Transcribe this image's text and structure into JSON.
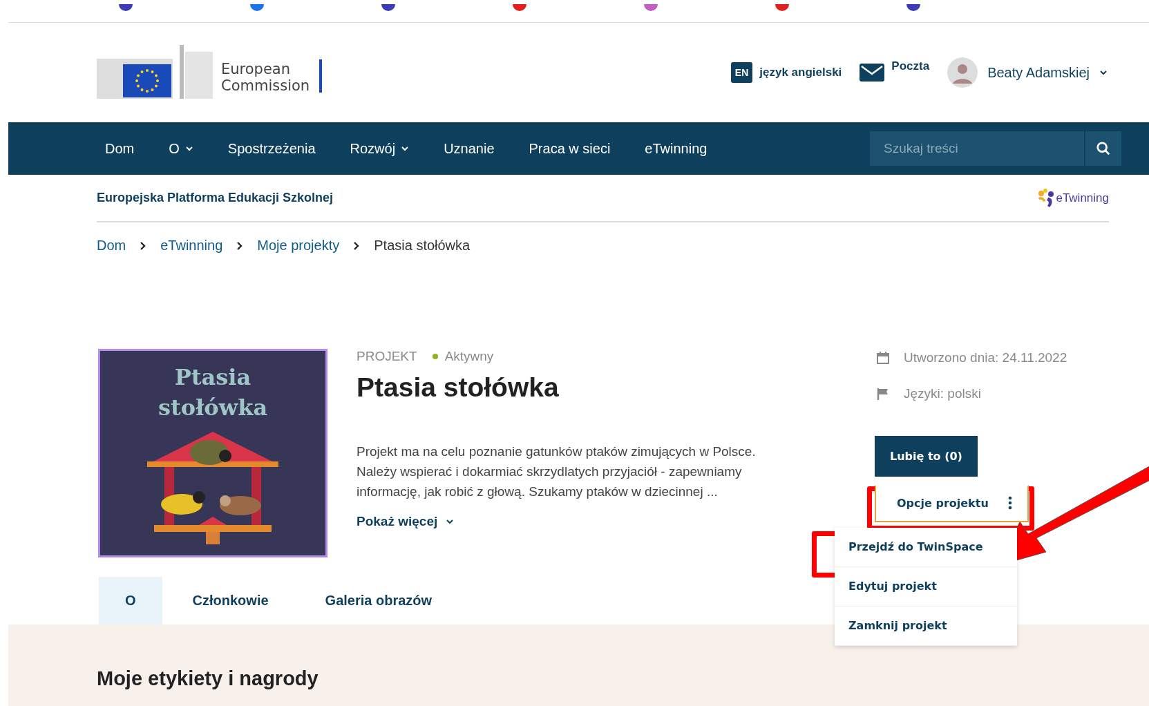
{
  "header": {
    "logo": {
      "line1": "European",
      "line2": "Commission"
    },
    "language": {
      "code": "EN",
      "label": "język angielski"
    },
    "mail": "Poczta",
    "user": "Beaty Adamskiej"
  },
  "nav": {
    "items": [
      {
        "label": "Dom",
        "dropdown": false
      },
      {
        "label": "O",
        "dropdown": true
      },
      {
        "label": "Spostrzeżenia",
        "dropdown": false
      },
      {
        "label": "Rozwój",
        "dropdown": true
      },
      {
        "label": "Uznanie",
        "dropdown": false
      },
      {
        "label": "Praca w sieci",
        "dropdown": false
      },
      {
        "label": "eTwinning",
        "dropdown": false
      }
    ],
    "search": {
      "placeholder": "Szukaj treści"
    }
  },
  "subheader": {
    "title": "Europejska Platforma Edukacji Szkolnej",
    "brand": "eTwinning"
  },
  "breadcrumb": [
    "Dom",
    "eTwinning",
    "Moje projekty",
    "Ptasia stołówka"
  ],
  "project": {
    "cover": {
      "line1": "Ptasia",
      "line2": "stołówka"
    },
    "type": "PROJEKT",
    "status": {
      "label": "Aktywny",
      "color": "#8cb31a"
    },
    "title": "Ptasia stołówka",
    "description": "Projekt ma na celu poznanie gatunków ptaków zimujących w Polsce. Należy wspierać i dokarmiać skrzydlatych przyjaciół - zapewniamy informację, jak robić z głową. Szukamy ptaków w dziecinnej ...",
    "show_more": "Pokaż więcej",
    "created": "Utworzono dnia: 24.11.2022",
    "languages": "Języki: polski",
    "like_button": "Lubię to (0)",
    "options_button": "Opcje projektu",
    "menu_open": true,
    "menu": [
      "Przejdź do TwinSpace",
      "Edytuj projekt",
      "Zamknij projekt"
    ]
  },
  "tabs": [
    {
      "label": "O",
      "selected": true
    },
    {
      "label": "Członkowie",
      "selected": false
    },
    {
      "label": "Galeria obrazów",
      "selected": false
    }
  ],
  "section_title": "Moje etykiety i nagrody"
}
